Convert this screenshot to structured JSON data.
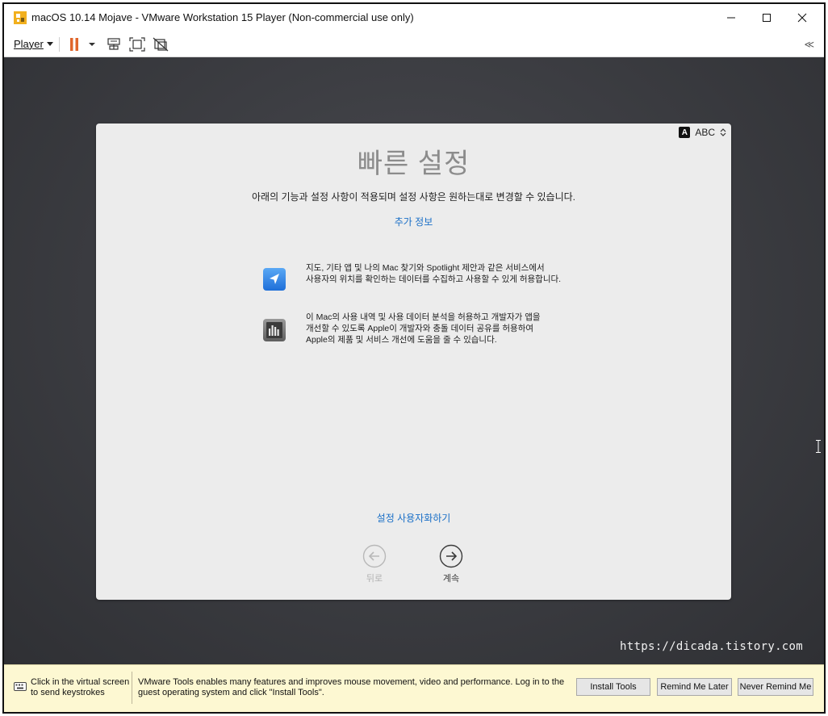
{
  "window": {
    "title": "macOS 10.14 Mojave - VMware Workstation 15 Player (Non-commercial use only)"
  },
  "toolbar": {
    "player_menu_label": "Player",
    "collapse_glyph": "≪",
    "icons": [
      "pause-icon",
      "send-ctrl-alt-del-icon",
      "fullscreen-icon",
      "unity-icon"
    ]
  },
  "setup": {
    "input_source_badge": "A",
    "input_source_label": "ABC",
    "title": "빠른 설정",
    "subtitle": "아래의 기능과 설정 사항이 적용되며 설정 사항은 원하는대로 변경할 수 있습니다.",
    "more_info_link": "추가 정보",
    "features": [
      {
        "icon": "location-arrow-icon",
        "text_lines": [
          "지도, 기타 앱 및 나의 Mac 찾기와 Spotlight 제안과 같은 서비스에서",
          "사용자의 위치를 확인하는 데이터를 수집하고 사용할 수 있게 허용합니다."
        ]
      },
      {
        "icon": "analytics-chart-icon",
        "text_lines": [
          "이 Mac의 사용 내역 및 사용 데이터 분석을 허용하고 개발자가 앱을",
          "개선할 수 있도록 Apple이 개발자와 충돌 데이터 공유를 허용하여",
          "Apple의 제품 및 서비스 개선에 도움을 줄 수 있습니다."
        ]
      }
    ],
    "customize_link": "설정 사용자화하기",
    "back_label": "뒤로",
    "continue_label": "계속"
  },
  "watermark": "https://dicada.tistory.com",
  "notification": {
    "click_hint_lines": [
      "Click in the virtual screen",
      "to send keystrokes"
    ],
    "message": "VMware Tools enables many features and improves mouse movement, video and performance. Log in to the guest operating system and click \"Install Tools\".",
    "install_button": "Install Tools",
    "remind_later_button": "Remind Me Later",
    "never_remind_button": "Never Remind Me"
  },
  "colors": {
    "link_blue": "#1a6fc7",
    "pause_orange": "#e0652b",
    "guest_background": "#3d3e43",
    "notify_background": "#fdf8d2"
  }
}
